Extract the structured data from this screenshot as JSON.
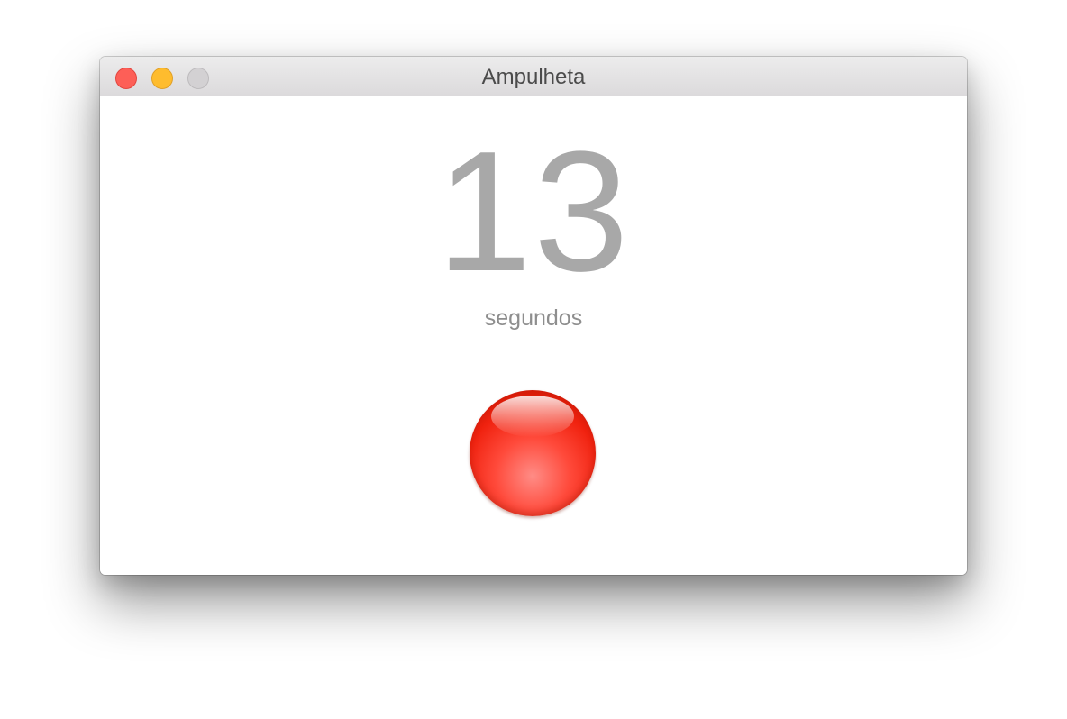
{
  "window": {
    "title": "Ampulheta"
  },
  "timer": {
    "value": "13",
    "unit": "segundos"
  },
  "icons": {
    "close": "close-button",
    "minimize": "minimize-button",
    "maximize": "zoom-button",
    "action": "red-orb-button"
  },
  "colors": {
    "close": "#fd5f57",
    "minimize": "#febc2e",
    "zoom_disabled": "#d3d1d3",
    "number": "#a8a8a8",
    "orb": "#f0220f"
  }
}
